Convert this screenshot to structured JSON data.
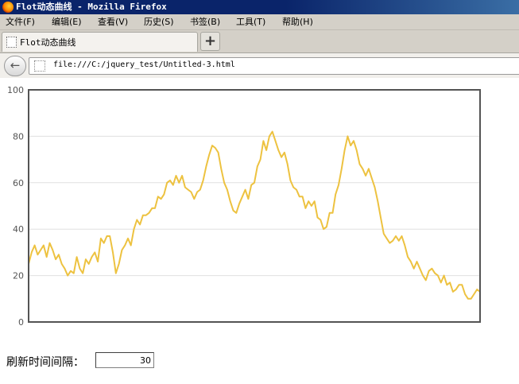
{
  "window": {
    "title": "Flot动态曲线 - Mozilla Firefox"
  },
  "menu": [
    "文件(F)",
    "编辑(E)",
    "查看(V)",
    "历史(S)",
    "书签(B)",
    "工具(T)",
    "帮助(H)"
  ],
  "tabs": [
    {
      "label": "Flot动态曲线"
    }
  ],
  "newtab_label": "+",
  "navbar": {
    "url": "file:///C:/jquery_test/Untitled-3.html"
  },
  "refresh": {
    "label": "刷新时间间隔：",
    "value": "30"
  },
  "chart_data": {
    "type": "line",
    "title": "",
    "xlabel": "",
    "ylabel": "",
    "ylim": [
      0,
      100
    ],
    "yticks": [
      0,
      20,
      40,
      60,
      80,
      100
    ],
    "grid": true,
    "line_color": "#edc240",
    "series": [
      {
        "values": [
          25,
          30,
          33,
          29,
          31,
          33,
          28,
          34,
          31,
          27,
          29,
          25,
          23,
          20,
          22,
          21,
          28,
          23,
          21,
          27,
          25,
          28,
          30,
          26,
          36,
          34,
          37,
          37,
          30,
          21,
          25,
          31,
          33,
          36,
          33,
          40,
          44,
          42,
          46,
          46,
          47,
          49,
          49,
          54,
          53,
          55,
          60,
          61,
          59,
          63,
          60,
          63,
          58,
          57,
          56,
          53,
          56,
          57,
          61,
          67,
          72,
          76,
          75,
          73,
          66,
          60,
          57,
          52,
          48,
          47,
          51,
          54,
          57,
          53,
          59,
          60,
          67,
          70,
          78,
          74,
          80,
          82,
          78,
          74,
          71,
          73,
          68,
          61,
          58,
          57,
          54,
          54,
          49,
          52,
          50,
          52,
          45,
          44,
          40,
          41,
          47,
          47,
          55,
          59,
          66,
          74,
          80,
          76,
          78,
          74,
          68,
          66,
          63,
          66,
          62,
          58,
          52,
          45,
          38,
          36,
          34,
          35,
          37,
          35,
          37,
          33,
          28,
          26,
          23,
          26,
          23,
          20,
          18,
          22,
          23,
          21,
          20,
          17,
          20,
          16,
          17,
          13,
          14,
          16,
          16,
          12,
          10,
          10,
          12,
          14,
          13
        ]
      }
    ]
  }
}
